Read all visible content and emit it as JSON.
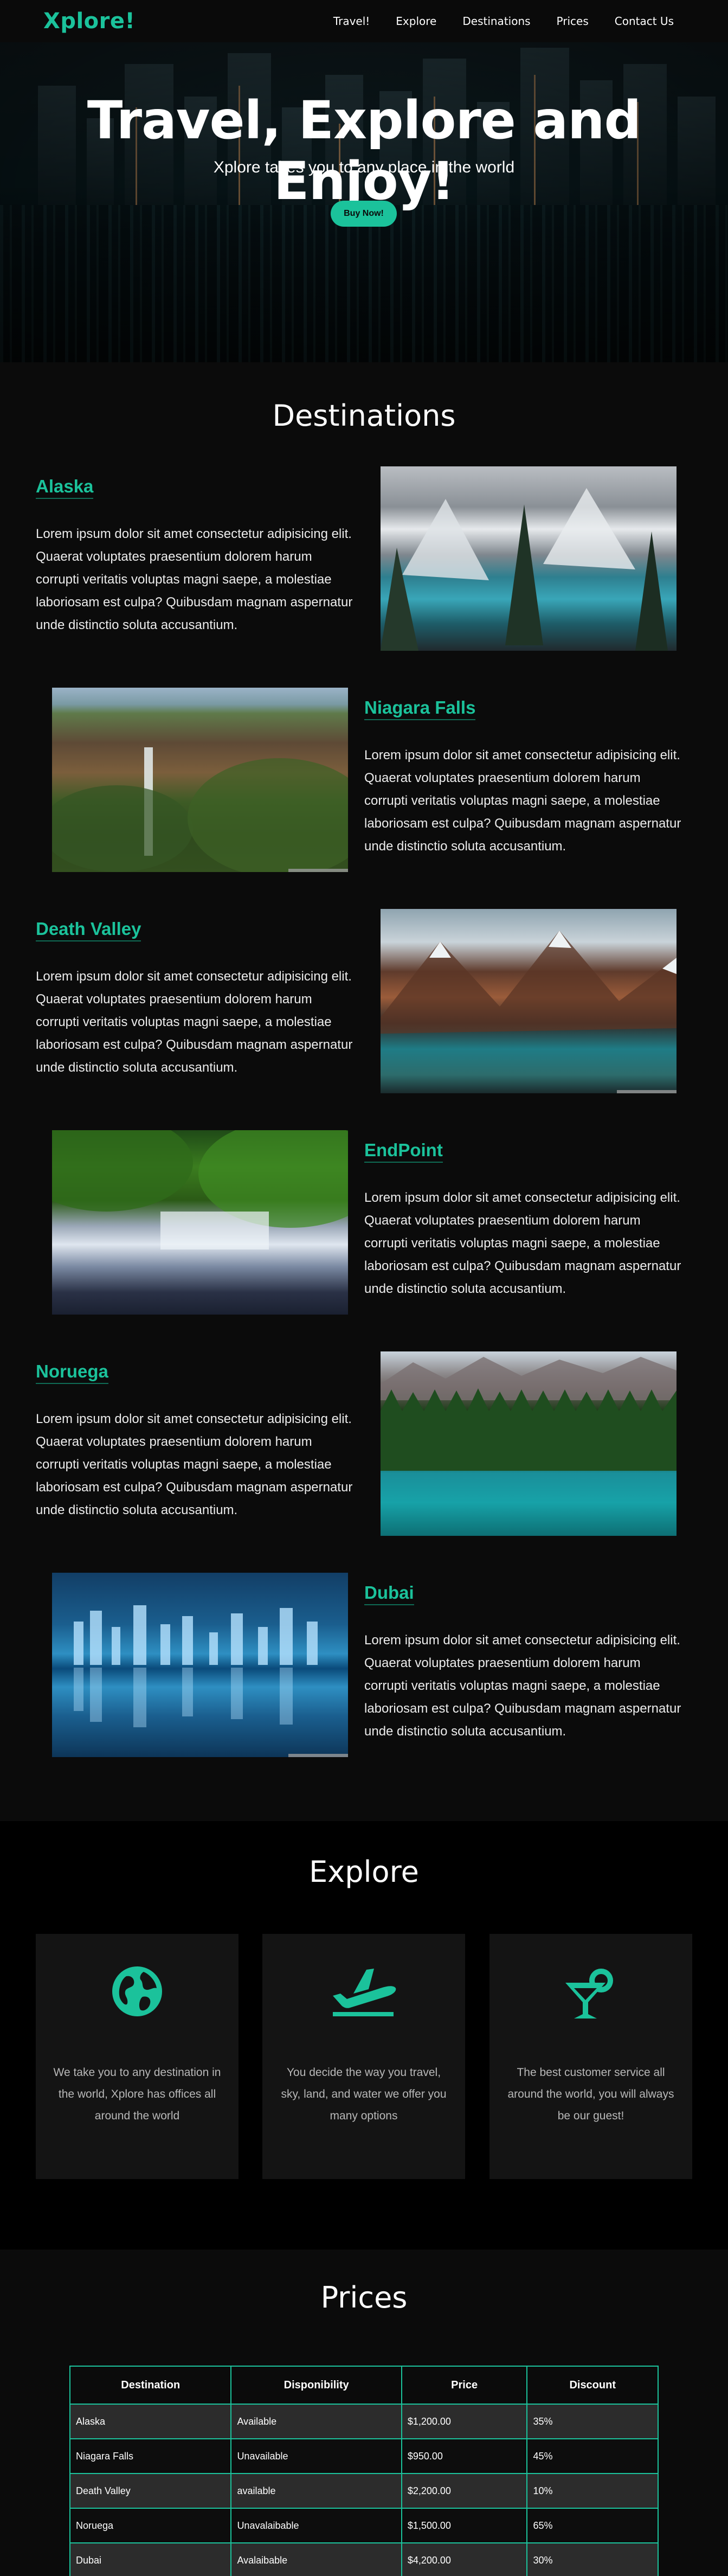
{
  "nav": {
    "brand": "Xplore!",
    "items": [
      {
        "label": "Travel!"
      },
      {
        "label": "Explore"
      },
      {
        "label": "Destinations"
      },
      {
        "label": "Prices"
      },
      {
        "label": "Contact Us"
      }
    ]
  },
  "hero": {
    "title": "Travel, Explore and Enjoy!",
    "subtitle": "Xplore takes you to any place in the world",
    "button": "Buy Now!"
  },
  "destinations": {
    "title": "Destinations",
    "items": [
      {
        "name": "Alaska",
        "text": "Lorem ipsum dolor sit amet consectetur adipisicing elit. Quaerat voluptates praesentium dolorem harum corrupti veritatis voluptas magni saepe, a molestiae laboriosam est culpa? Quibusdam magnam aspernatur unde distinctio soluta accusantium."
      },
      {
        "name": "Niagara Falls",
        "text": "Lorem ipsum dolor sit amet consectetur adipisicing elit. Quaerat voluptates praesentium dolorem harum corrupti veritatis voluptas magni saepe, a molestiae laboriosam est culpa? Quibusdam magnam aspernatur unde distinctio soluta accusantium."
      },
      {
        "name": "Death Valley",
        "text": "Lorem ipsum dolor sit amet consectetur adipisicing elit. Quaerat voluptates praesentium dolorem harum corrupti veritatis voluptas magni saepe, a molestiae laboriosam est culpa? Quibusdam magnam aspernatur unde distinctio soluta accusantium."
      },
      {
        "name": "EndPoint",
        "text": "Lorem ipsum dolor sit amet consectetur adipisicing elit. Quaerat voluptates praesentium dolorem harum corrupti veritatis voluptas magni saepe, a molestiae laboriosam est culpa? Quibusdam magnam aspernatur unde distinctio soluta accusantium."
      },
      {
        "name": "Noruega",
        "text": "Lorem ipsum dolor sit amet consectetur adipisicing elit. Quaerat voluptates praesentium dolorem harum corrupti veritatis voluptas magni saepe, a molestiae laboriosam est culpa? Quibusdam magnam aspernatur unde distinctio soluta accusantium."
      },
      {
        "name": "Dubai",
        "text": "Lorem ipsum dolor sit amet consectetur adipisicing elit. Quaerat voluptates praesentium dolorem harum corrupti veritatis voluptas magni saepe, a molestiae laboriosam est culpa? Quibusdam magnam aspernatur unde distinctio soluta accusantium."
      }
    ]
  },
  "explore": {
    "title": "Explore",
    "cards": [
      {
        "icon": "globe-icon",
        "text": "We take you to any destination in the world, Xplore has offices all around the world"
      },
      {
        "icon": "plane-departure-icon",
        "text": "You decide the way you travel, sky, land, and water we offer you many options"
      },
      {
        "icon": "cocktail-icon",
        "text": "The best customer service all around the world, you will always be our guest!"
      }
    ]
  },
  "prices": {
    "title": "Prices",
    "headers": [
      "Destination",
      "Disponibility",
      "Price",
      "Discount"
    ],
    "rows": [
      [
        "Alaska",
        "Available",
        "$1,200.00",
        "35%"
      ],
      [
        "Niagara Falls",
        "Unavailable",
        "$950.00",
        "45%"
      ],
      [
        "Death Valley",
        "available",
        "$2,200.00",
        "10%"
      ],
      [
        "Noruega",
        "Unavalaibable",
        "$1,500.00",
        "65%"
      ],
      [
        "Dubai",
        "Avalaibable",
        "$4,200.00",
        "30%"
      ]
    ]
  },
  "colors": {
    "accent": "#1bc29b",
    "background": "#0b0b0b",
    "card": "#141414"
  }
}
